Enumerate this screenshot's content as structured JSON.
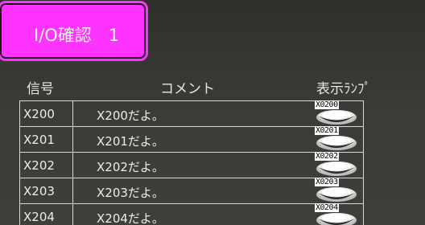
{
  "title": "I/O確認　1",
  "headers": {
    "signal": "信号",
    "comment": "コメント",
    "lamp": "表示ﾗﾝﾌﾟ"
  },
  "rows": [
    {
      "signal": "X200",
      "comment": "X200だよ。",
      "lamp": "X0200"
    },
    {
      "signal": "X201",
      "comment": "X201だよ。",
      "lamp": "X0201"
    },
    {
      "signal": "X202",
      "comment": "X202だよ。",
      "lamp": "X0202"
    },
    {
      "signal": "X203",
      "comment": "X203だよ。",
      "lamp": "X0203"
    },
    {
      "signal": "X204",
      "comment": "X204だよ。",
      "lamp": "X0204"
    }
  ],
  "colors": {
    "title_bg": "#ff33ff",
    "background": "#3a3a37",
    "grid_line": "#d8d8d8"
  },
  "icons": {
    "lamp": "lamp-icon"
  }
}
